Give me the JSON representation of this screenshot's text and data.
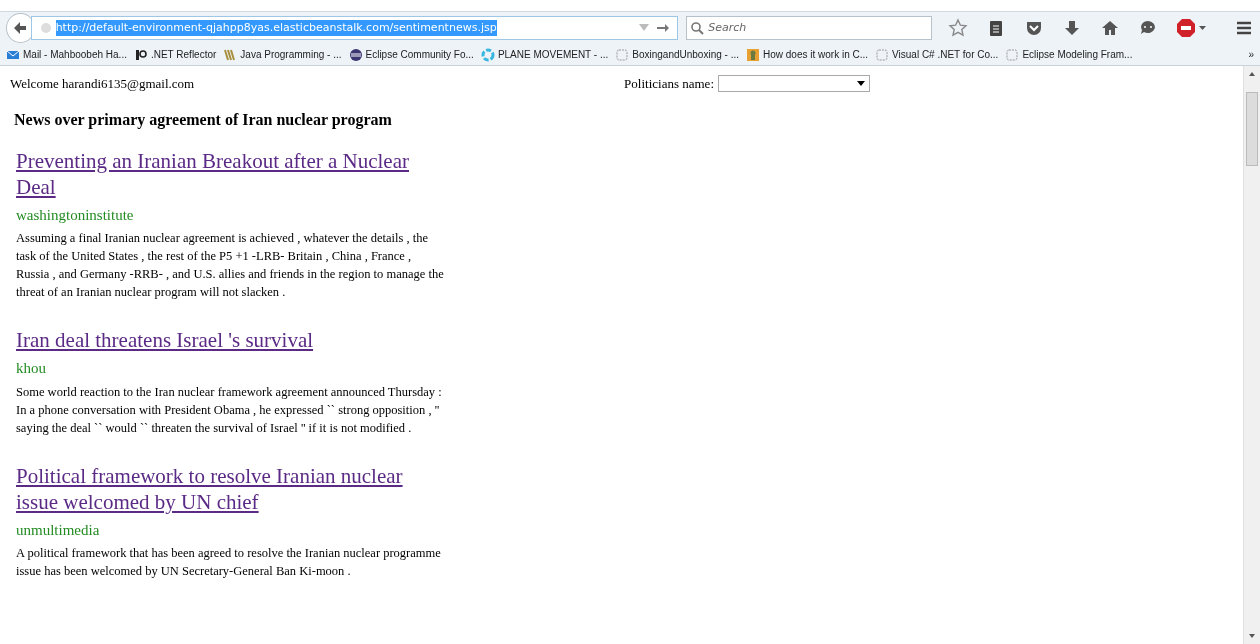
{
  "browser": {
    "url": "http://default-environment-qjahpp8yas.elasticbeanstalk.com/sentimentnews.jsp",
    "search_placeholder": "Search",
    "bookmarks": [
      {
        "label": "Mail - Mahboobeh Ha...",
        "kind": "mail"
      },
      {
        "label": ".NET Reflector",
        "kind": "rg"
      },
      {
        "label": "Java Programming - ...",
        "kind": "books"
      },
      {
        "label": "Eclipse Community Fo...",
        "kind": "eclipse"
      },
      {
        "label": "PLANE MOVEMENT - ...",
        "kind": "ring"
      },
      {
        "label": "BoxingandUnboxing - ...",
        "kind": "blank"
      },
      {
        "label": "How does it work in C...",
        "kind": "figure"
      },
      {
        "label": "Visual C# .NET for Co...",
        "kind": "blank"
      },
      {
        "label": "Eclipse Modeling Fram...",
        "kind": "blank"
      }
    ],
    "overflow": "»"
  },
  "page": {
    "welcome": "Welcome harandi6135@gmail.com",
    "politicians_label": "Politicians name:",
    "heading": "News over primary agreement of Iran nuclear program",
    "articles": [
      {
        "title": "Preventing an Iranian Breakout after a Nuclear Deal",
        "source": "washingtoninstitute",
        "summary": "Assuming a final Iranian nuclear agreement is achieved , whatever the details , the task of the United States , the rest of the P5 +1 -LRB- Britain , China , France , Russia , and Germany -RRB- , and U.S. allies and friends in the region to manage the threat of an Iranian nuclear program will not slacken ."
      },
      {
        "title": "Iran deal threatens Israel 's survival",
        "source": "khou",
        "summary": "Some world reaction to the Iran nuclear framework agreement announced Thursday : In a phone conversation with President Obama , he expressed `` strong opposition , '' saying the deal `` would `` threaten the survival of Israel '' if it is not modified ."
      },
      {
        "title": "Political framework to resolve Iranian nuclear issue welcomed by UN chief",
        "source": "unmultimedia",
        "summary": "A political framework that has been agreed to resolve the Iranian nuclear programme issue has been welcomed by UN Secretary-General Ban Ki-moon ."
      }
    ]
  }
}
